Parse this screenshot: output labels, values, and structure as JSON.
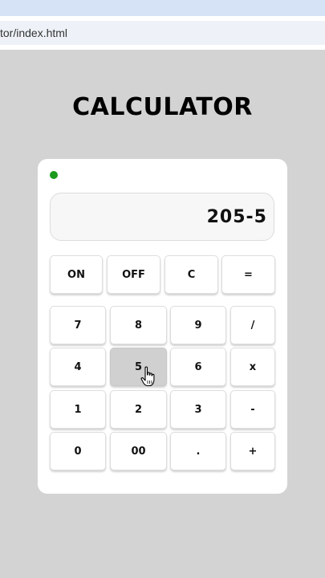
{
  "browser": {
    "url": "tor/index.html"
  },
  "app": {
    "title": "CALCULATOR"
  },
  "display": {
    "value": "205-5"
  },
  "controls": {
    "on": "ON",
    "off": "OFF",
    "clear": "C",
    "equals": "="
  },
  "keys": {
    "k7": "7",
    "k8": "8",
    "k9": "9",
    "divide": "/",
    "k4": "4",
    "k5": "5",
    "k6": "6",
    "multiply": "x",
    "k1": "1",
    "k2": "2",
    "k3": "3",
    "minus": "-",
    "k0": "0",
    "k00": "00",
    "dot": ".",
    "plus": "+"
  },
  "state": {
    "pressed_key": "5",
    "power_led_color": "#1c9a1c"
  }
}
